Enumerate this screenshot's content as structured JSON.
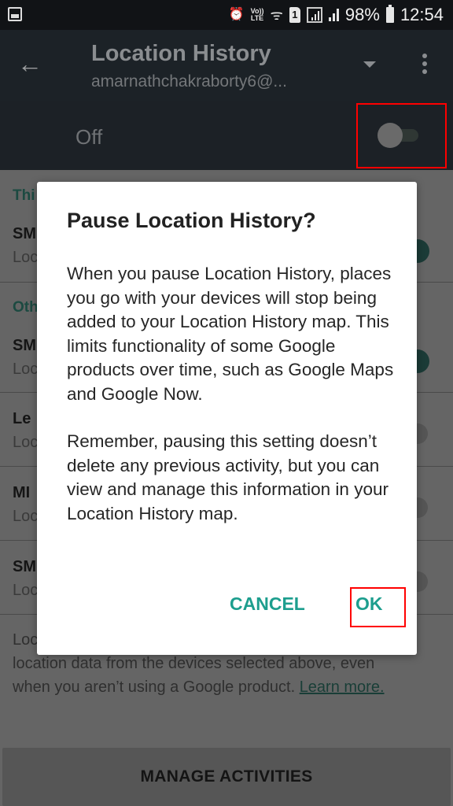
{
  "status_bar": {
    "left_icon": "gallery-icon",
    "icons": [
      "alarm-icon",
      "volte-icon",
      "wifi-icon",
      "sim-1-icon",
      "signal-sim1-icon",
      "signal-sim2-icon",
      "battery-icon"
    ],
    "volte_label": "Vo))",
    "lte_label": "LTE",
    "sim_label": "1",
    "battery_percent": "98%",
    "time": "12:54"
  },
  "app_bar": {
    "title": "Location History",
    "account": "amarnathchakraborty6@..."
  },
  "master_toggle": {
    "label": "Off",
    "state": "off"
  },
  "list": {
    "sections": [
      {
        "header": "Thi",
        "items": [
          {
            "title": "SM",
            "subtitle": "Loc",
            "toggle": "on"
          }
        ]
      },
      {
        "header": "Oth",
        "items": [
          {
            "title": "SM",
            "subtitle": "Loc",
            "toggle": "on"
          },
          {
            "title": "Le",
            "subtitle": "Loc",
            "toggle": "off"
          },
          {
            "title": "MI",
            "subtitle": "Loc",
            "toggle": "off"
          },
          {
            "title": "SM",
            "subtitle": "Loc",
            "toggle": "off"
          }
        ]
      }
    ],
    "footer_start": "Loc",
    "footer_line2": "location data from the devices selected above, even",
    "footer_line3": "when you aren’t using a Google product. ",
    "learn_more": "Learn more.",
    "manage_button": "MANAGE ACTIVITIES"
  },
  "dialog": {
    "title": "Pause Location History?",
    "paragraph1": "When you pause Location History, places you go with your devices will stop being added to your Location History map. This limits functionality of some Google products over time, such as Google Maps and Google Now.",
    "paragraph2": "Remember, pausing this setting doesn’t delete any previous activity, but you can view and manage this information in your Location History map.",
    "cancel_label": "CANCEL",
    "ok_label": "OK"
  },
  "colors": {
    "accent": "#1d9e8e",
    "highlight_box": "#ff0000",
    "app_bar_bg": "#1c2227"
  }
}
